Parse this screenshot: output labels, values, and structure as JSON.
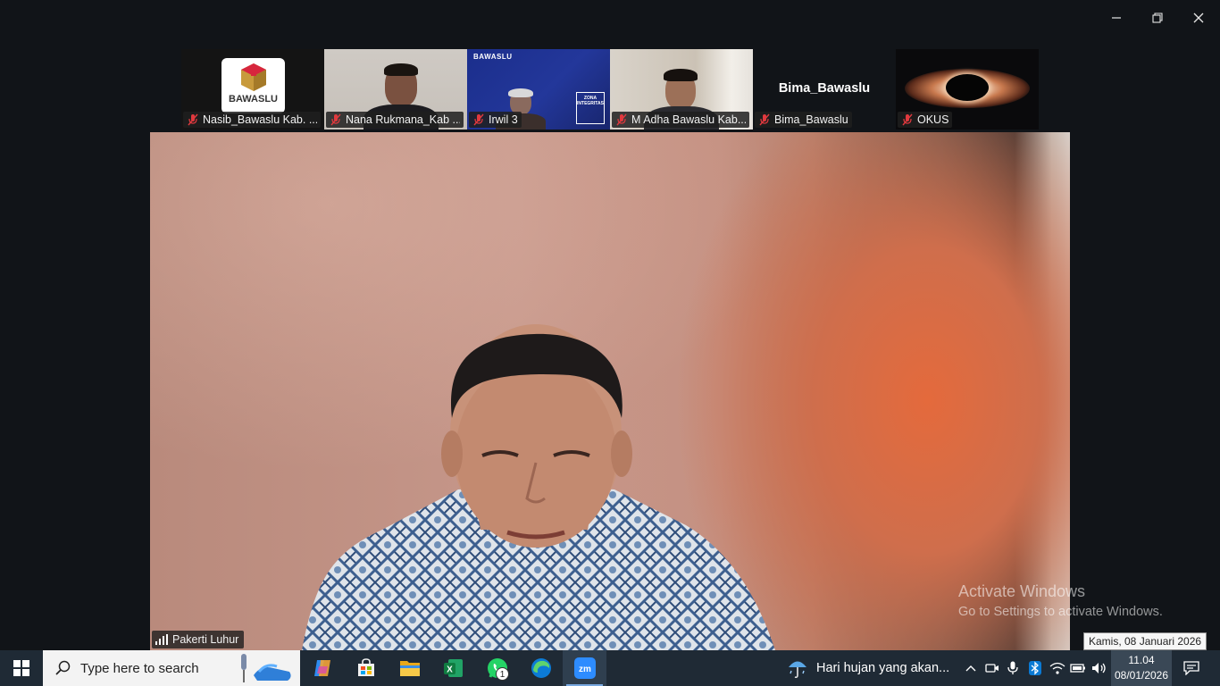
{
  "window": {
    "controls": [
      "minimize",
      "restore",
      "close"
    ]
  },
  "thumbnails": [
    {
      "name": "Nasib_Bawaslu Kab. ...",
      "muted": true,
      "logo_text": "BAWASLU"
    },
    {
      "name": "Nana Rukmana_Kab ...",
      "muted": true
    },
    {
      "name": "Irwil 3",
      "muted": true,
      "slide_brand": "BAWASLU",
      "slide_text": "ZONA INTEGRITAS"
    },
    {
      "name": "M Adha Bawaslu Kab...",
      "muted": true
    },
    {
      "name": "Bima_Bawaslu",
      "muted": true,
      "display_name": "Bima_Bawaslu"
    },
    {
      "name": "OKUS",
      "muted": true
    }
  ],
  "main_video": {
    "speaker": "Pakerti Luhur"
  },
  "watermark": {
    "line1": "Activate Windows",
    "line2": "Go to Settings to activate Windows."
  },
  "tooltip": "Kamis, 08 Januari 2026",
  "taskbar": {
    "search_placeholder": "Type here to search",
    "apps": [
      {
        "icon": "copilot-icon"
      },
      {
        "icon": "store-icon"
      },
      {
        "icon": "file-explorer-icon"
      },
      {
        "icon": "excel-icon",
        "label": "X"
      },
      {
        "icon": "whatsapp-icon",
        "badge": "1"
      },
      {
        "icon": "edge-icon"
      },
      {
        "icon": "zoom-icon",
        "label": "zm",
        "active": true
      }
    ],
    "weather": "Hari hujan yang akan...",
    "clock_time": "11.04",
    "clock_date": "08/01/2026"
  },
  "colors": {
    "background": "#111418",
    "taskbar": "#1f2a35",
    "mute_red": "#e0393e",
    "zoom_blue": "#2d8cff"
  }
}
